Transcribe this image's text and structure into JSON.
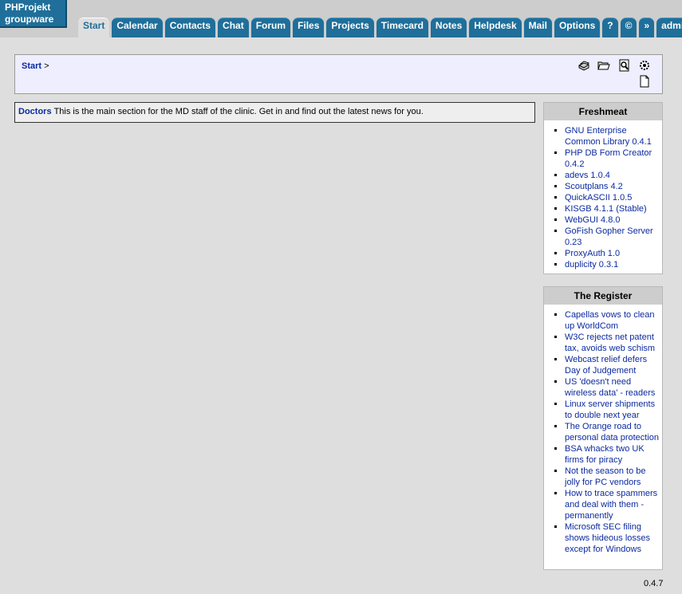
{
  "header": {
    "logo_line1": "PHProjekt",
    "logo_line2": "groupware",
    "tabs": [
      {
        "label": "Start",
        "active": true
      },
      {
        "label": "Calendar"
      },
      {
        "label": "Contacts"
      },
      {
        "label": "Chat"
      },
      {
        "label": "Forum"
      },
      {
        "label": "Files"
      },
      {
        "label": "Projects"
      },
      {
        "label": "Timecard"
      },
      {
        "label": "Notes"
      },
      {
        "label": "Helpdesk"
      },
      {
        "label": "Mail"
      },
      {
        "label": "Options"
      },
      {
        "label": "?"
      },
      {
        "label": "©"
      },
      {
        "label": "»"
      },
      {
        "label": "admin"
      }
    ]
  },
  "breadcrumb": {
    "link": "Start",
    "separator": ">"
  },
  "toolbar_icons": [
    "print-icon",
    "open-folder-icon",
    "search-document-icon",
    "settings-gear-icon",
    "new-document-icon"
  ],
  "info": {
    "link": "Doctors",
    "text": "This is the main section for the MD staff of the clinic. Get in and find out the latest news for you."
  },
  "freshmeat": {
    "title": "Freshmeat",
    "items": [
      "GNU Enterprise Common Library 0.4.1",
      "PHP DB Form Creator 0.4.2",
      "adevs 1.0.4",
      "Scoutplans 4.2",
      "QuickASCII 1.0.5",
      "KISGB 4.1.1 (Stable)",
      "WebGUI 4.8.0",
      "GoFish Gopher Server 0.23",
      "ProxyAuth 1.0",
      "duplicity 0.3.1"
    ]
  },
  "register": {
    "title": "The Register",
    "items": [
      "Capellas vows to clean up WorldCom",
      "W3C rejects net patent tax, avoids web schism",
      "Webcast relief defers Day of Judgement",
      "US 'doesn't need wireless data' - readers",
      "Linux server shipments to double next year",
      "The Orange road to personal data protection",
      "BSA whacks two UK firms for piracy",
      "Not the season to be jolly for PC vendors",
      "How to trace spammers and deal with them - permanently",
      "Microsoft SEC filing shows hideous losses except for Windows"
    ]
  },
  "footer": {
    "version": "0.4.7"
  }
}
